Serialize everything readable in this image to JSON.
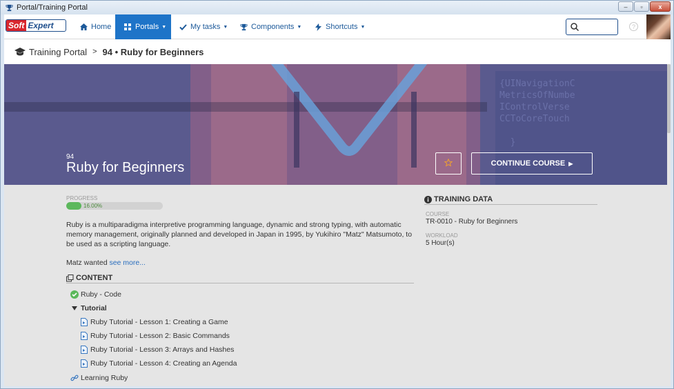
{
  "window": {
    "title": "Portal/Training Portal",
    "minimize": "–",
    "restore": "▫",
    "close": "x"
  },
  "nav": {
    "items": [
      {
        "label": "Home"
      },
      {
        "label": "Portals"
      },
      {
        "label": "My tasks"
      },
      {
        "label": "Components"
      },
      {
        "label": "Shortcuts"
      }
    ],
    "logo_soft": "Soft",
    "logo_expert": "Expert",
    "help": "?"
  },
  "breadcrumb": {
    "root": "Training Portal",
    "current": "94 • Ruby for Beginners"
  },
  "hero": {
    "code_lines": "{UINavigationC\nMetricsOfNumbe\nIControlVerse\nCCToCoreTouch\n\n  }",
    "number": "94",
    "title": "Ruby for Beginners",
    "continue_label": "CONTINUE COURSE"
  },
  "progress": {
    "label": "PROGRESS",
    "value": 0.16,
    "text": "16.00%"
  },
  "description": "Ruby is a multiparadigma interpretive programming language, dynamic and strong typing, with automatic memory management, originally planned and developed in Japan in 1995, by Yukihiro \"Matz\" Matsumoto, to be used as a scripting language.",
  "more": {
    "prefix": "Matz wanted ",
    "link": "see more..."
  },
  "content": {
    "heading": "CONTENT",
    "items": [
      {
        "label": "Ruby - Code",
        "icon": "check-circle-icon"
      },
      {
        "label": "Tutorial",
        "icon": "caret-down-icon"
      },
      {
        "label": "Ruby Tutorial - Lesson 1: Creating a Game",
        "icon": "video-doc-icon"
      },
      {
        "label": "Ruby Tutorial - Lesson 2: Basic Commands",
        "icon": "video-doc-icon"
      },
      {
        "label": "Ruby Tutorial - Lesson 3: Arrays and Hashes",
        "icon": "video-doc-icon"
      },
      {
        "label": "Ruby Tutorial - Lesson 4: Creating an Agenda",
        "icon": "video-doc-icon"
      },
      {
        "label": "Learning Ruby",
        "icon": "link-icon"
      }
    ]
  },
  "training_data": {
    "heading": "TRAINING DATA",
    "course_label": "COURSE",
    "course_value": "TR-0010 - Ruby for Beginners",
    "workload_label": "WORKLOAD",
    "workload_value": "5 Hour(s)"
  },
  "colors": {
    "accent": "#1e74c8",
    "hero": "#5a5a8e",
    "progress": "#5cb85c",
    "link": "#2a6ebd"
  }
}
